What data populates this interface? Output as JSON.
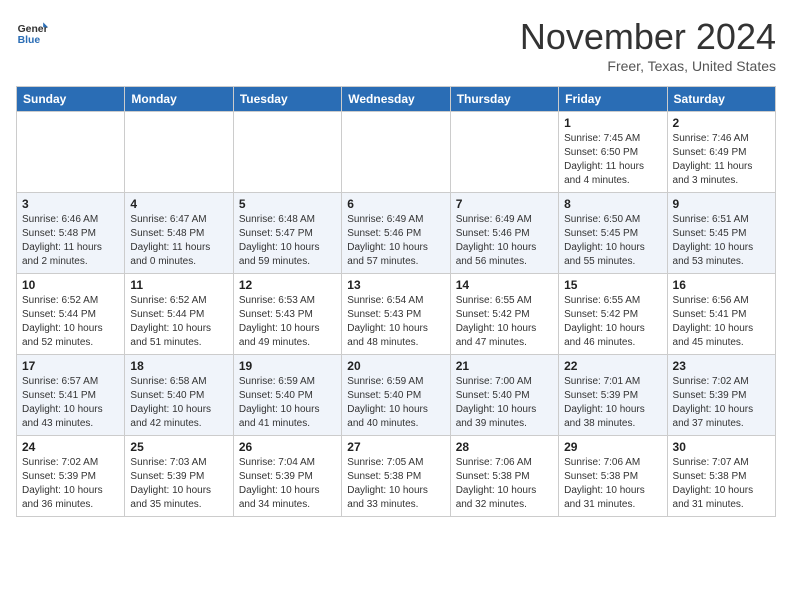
{
  "header": {
    "logo_general": "General",
    "logo_blue": "Blue",
    "month_title": "November 2024",
    "location": "Freer, Texas, United States"
  },
  "weekdays": [
    "Sunday",
    "Monday",
    "Tuesday",
    "Wednesday",
    "Thursday",
    "Friday",
    "Saturday"
  ],
  "weeks": [
    [
      {
        "day": "",
        "info": ""
      },
      {
        "day": "",
        "info": ""
      },
      {
        "day": "",
        "info": ""
      },
      {
        "day": "",
        "info": ""
      },
      {
        "day": "",
        "info": ""
      },
      {
        "day": "1",
        "info": "Sunrise: 7:45 AM\nSunset: 6:50 PM\nDaylight: 11 hours and 4 minutes."
      },
      {
        "day": "2",
        "info": "Sunrise: 7:46 AM\nSunset: 6:49 PM\nDaylight: 11 hours and 3 minutes."
      }
    ],
    [
      {
        "day": "3",
        "info": "Sunrise: 6:46 AM\nSunset: 5:48 PM\nDaylight: 11 hours and 2 minutes."
      },
      {
        "day": "4",
        "info": "Sunrise: 6:47 AM\nSunset: 5:48 PM\nDaylight: 11 hours and 0 minutes."
      },
      {
        "day": "5",
        "info": "Sunrise: 6:48 AM\nSunset: 5:47 PM\nDaylight: 10 hours and 59 minutes."
      },
      {
        "day": "6",
        "info": "Sunrise: 6:49 AM\nSunset: 5:46 PM\nDaylight: 10 hours and 57 minutes."
      },
      {
        "day": "7",
        "info": "Sunrise: 6:49 AM\nSunset: 5:46 PM\nDaylight: 10 hours and 56 minutes."
      },
      {
        "day": "8",
        "info": "Sunrise: 6:50 AM\nSunset: 5:45 PM\nDaylight: 10 hours and 55 minutes."
      },
      {
        "day": "9",
        "info": "Sunrise: 6:51 AM\nSunset: 5:45 PM\nDaylight: 10 hours and 53 minutes."
      }
    ],
    [
      {
        "day": "10",
        "info": "Sunrise: 6:52 AM\nSunset: 5:44 PM\nDaylight: 10 hours and 52 minutes."
      },
      {
        "day": "11",
        "info": "Sunrise: 6:52 AM\nSunset: 5:44 PM\nDaylight: 10 hours and 51 minutes."
      },
      {
        "day": "12",
        "info": "Sunrise: 6:53 AM\nSunset: 5:43 PM\nDaylight: 10 hours and 49 minutes."
      },
      {
        "day": "13",
        "info": "Sunrise: 6:54 AM\nSunset: 5:43 PM\nDaylight: 10 hours and 48 minutes."
      },
      {
        "day": "14",
        "info": "Sunrise: 6:55 AM\nSunset: 5:42 PM\nDaylight: 10 hours and 47 minutes."
      },
      {
        "day": "15",
        "info": "Sunrise: 6:55 AM\nSunset: 5:42 PM\nDaylight: 10 hours and 46 minutes."
      },
      {
        "day": "16",
        "info": "Sunrise: 6:56 AM\nSunset: 5:41 PM\nDaylight: 10 hours and 45 minutes."
      }
    ],
    [
      {
        "day": "17",
        "info": "Sunrise: 6:57 AM\nSunset: 5:41 PM\nDaylight: 10 hours and 43 minutes."
      },
      {
        "day": "18",
        "info": "Sunrise: 6:58 AM\nSunset: 5:40 PM\nDaylight: 10 hours and 42 minutes."
      },
      {
        "day": "19",
        "info": "Sunrise: 6:59 AM\nSunset: 5:40 PM\nDaylight: 10 hours and 41 minutes."
      },
      {
        "day": "20",
        "info": "Sunrise: 6:59 AM\nSunset: 5:40 PM\nDaylight: 10 hours and 40 minutes."
      },
      {
        "day": "21",
        "info": "Sunrise: 7:00 AM\nSunset: 5:40 PM\nDaylight: 10 hours and 39 minutes."
      },
      {
        "day": "22",
        "info": "Sunrise: 7:01 AM\nSunset: 5:39 PM\nDaylight: 10 hours and 38 minutes."
      },
      {
        "day": "23",
        "info": "Sunrise: 7:02 AM\nSunset: 5:39 PM\nDaylight: 10 hours and 37 minutes."
      }
    ],
    [
      {
        "day": "24",
        "info": "Sunrise: 7:02 AM\nSunset: 5:39 PM\nDaylight: 10 hours and 36 minutes."
      },
      {
        "day": "25",
        "info": "Sunrise: 7:03 AM\nSunset: 5:39 PM\nDaylight: 10 hours and 35 minutes."
      },
      {
        "day": "26",
        "info": "Sunrise: 7:04 AM\nSunset: 5:39 PM\nDaylight: 10 hours and 34 minutes."
      },
      {
        "day": "27",
        "info": "Sunrise: 7:05 AM\nSunset: 5:38 PM\nDaylight: 10 hours and 33 minutes."
      },
      {
        "day": "28",
        "info": "Sunrise: 7:06 AM\nSunset: 5:38 PM\nDaylight: 10 hours and 32 minutes."
      },
      {
        "day": "29",
        "info": "Sunrise: 7:06 AM\nSunset: 5:38 PM\nDaylight: 10 hours and 31 minutes."
      },
      {
        "day": "30",
        "info": "Sunrise: 7:07 AM\nSunset: 5:38 PM\nDaylight: 10 hours and 31 minutes."
      }
    ]
  ]
}
